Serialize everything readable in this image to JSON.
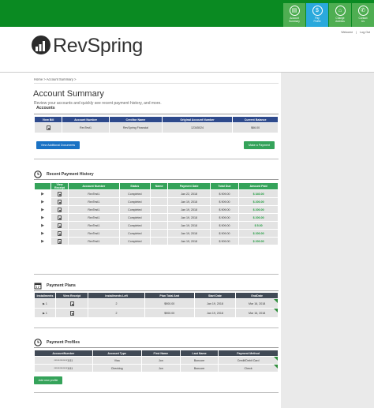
{
  "colors": {
    "topbar": "#0a8a22",
    "nav_green": "#4fae52",
    "nav_blue": "#2aa9dc",
    "accounts_header": "#2e4a8c",
    "history_header": "#35a35a",
    "plans_header": "#414a56",
    "amount_green": "#1a9a3a"
  },
  "topnav": [
    {
      "icon": "account-summary-icon",
      "label": "Account\nSummary"
    },
    {
      "icon": "pay-icon",
      "label": "Pay\nProfile"
    },
    {
      "icon": "change-address-icon",
      "label": "Change\nAddress"
    },
    {
      "icon": "contact-us-icon",
      "label": "Contact\nUs"
    }
  ],
  "utility": {
    "welcome": "Welcome",
    "logout": "Log Out"
  },
  "logo": {
    "text": "RevSpring"
  },
  "breadcrumb": "Home > Account Summary >",
  "page": {
    "title": "Account Summary",
    "subtitle": "Review your accounts and quickly see recent payment history, and more."
  },
  "accounts": {
    "heading": "Accounts",
    "columns": [
      "View Bill",
      "Account Number",
      "Creditor Name",
      "Original Account Number",
      "Current Balance"
    ],
    "rows": [
      {
        "account": "RevTest1",
        "creditor": "RevSpring Financial",
        "original": "12345024",
        "balance": "$66.00"
      }
    ],
    "view_docs_button": "View Additional Documents",
    "make_payment_button": "Make a Payment"
  },
  "history": {
    "heading": "Recent Payment History",
    "columns": [
      "View Receipt",
      "Account Number",
      "Status",
      "Name",
      "Payment Date",
      "Total Due",
      "Amount Paid"
    ],
    "rows": [
      {
        "account": "RevTest1",
        "status": "Completed",
        "name": "",
        "date": "Jan 22, 2018",
        "due": "$ 909.00",
        "paid": "$ 340.00"
      },
      {
        "account": "RevTest1",
        "status": "Completed",
        "name": "",
        "date": "Jan 19, 2018",
        "due": "$ 909.00",
        "paid": "$ 200.00"
      },
      {
        "account": "RevTest1",
        "status": "Completed",
        "name": "",
        "date": "Jan 19, 2018",
        "due": "$ 909.00",
        "paid": "$ 200.00"
      },
      {
        "account": "RevTest1",
        "status": "Completed",
        "name": "",
        "date": "Jan 19, 2018",
        "due": "$ 909.00",
        "paid": "$ 200.00"
      },
      {
        "account": "RevTest1",
        "status": "Completed",
        "name": "",
        "date": "Jan 19, 2018",
        "due": "$ 909.00",
        "paid": "$ 5.00"
      },
      {
        "account": "RevTest1",
        "status": "Completed",
        "name": "",
        "date": "Jan 19, 2018",
        "due": "$ 909.00",
        "paid": "$ 200.00"
      },
      {
        "account": "RevTest1",
        "status": "Completed",
        "name": "",
        "date": "Jan 19, 2018",
        "due": "$ 909.00",
        "paid": "$ 200.00"
      }
    ]
  },
  "plans": {
    "heading": "Payment Plans",
    "columns": [
      "Installments",
      "View Receipt",
      "Installments Left",
      "Plan Total Amt",
      "Start Date",
      "EndDate"
    ],
    "rows": [
      {
        "installments": "1",
        "left": "2",
        "total": "$900.00",
        "start": "Jan 19, 2018",
        "end": "Mar 16, 2018"
      },
      {
        "installments": "1",
        "left": "2",
        "total": "$900.00",
        "start": "Jan 19, 2018",
        "end": "Mar 16, 2018"
      }
    ]
  },
  "profiles": {
    "heading": "Payment Profiles",
    "columns": [
      "AccountNumber",
      "Account Type",
      "First Name",
      "Last Name",
      "Payment Method"
    ],
    "rows": [
      {
        "number": "************1111",
        "type": "Visa",
        "first": "Jon",
        "last": "Boncore",
        "method": "Credit/Debit Card"
      },
      {
        "number": "************1111",
        "type": "Checking",
        "first": "Jon",
        "last": "Boncore",
        "method": "Check"
      }
    ],
    "add_button": "Add new profile"
  }
}
